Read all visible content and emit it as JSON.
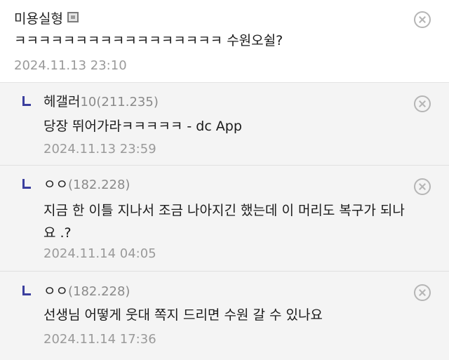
{
  "comments": [
    {
      "nickname": "미용실형",
      "text": "ㅋㅋㅋㅋㅋㅋㅋㅋㅋㅋㅋㅋㅋㅋㅋㅋㅋ 수원오쉴?",
      "date": "2024.11.13 23:10",
      "icon": "mobile-icon"
    },
    {
      "nickname": "헤갤러",
      "ip": "10(211.235)",
      "text": "당장 뛰어가라ㅋㅋㅋㅋㅋ - dc App",
      "date": "2024.11.13 23:59"
    },
    {
      "nickname": "ㅇㅇ",
      "ip": "(182.228)",
      "text_line1": "지금 한 이틀 지나서 조금 나아지긴 했는데 이 머리도 복구가 되나",
      "text_line2": "요 .?",
      "date": "2024.11.14 04:05"
    },
    {
      "nickname": "ㅇㅇ",
      "ip": "(182.228)",
      "text": "선생님 어떻게 웃대 쪽지 드리면 수원 갈 수 있나요",
      "date": "2024.11.14 17:36"
    }
  ],
  "colors": {
    "reply_bg": "#f4f4f4",
    "reply_arrow": "#3b3f9e",
    "meta_text": "#9a9a9a"
  }
}
